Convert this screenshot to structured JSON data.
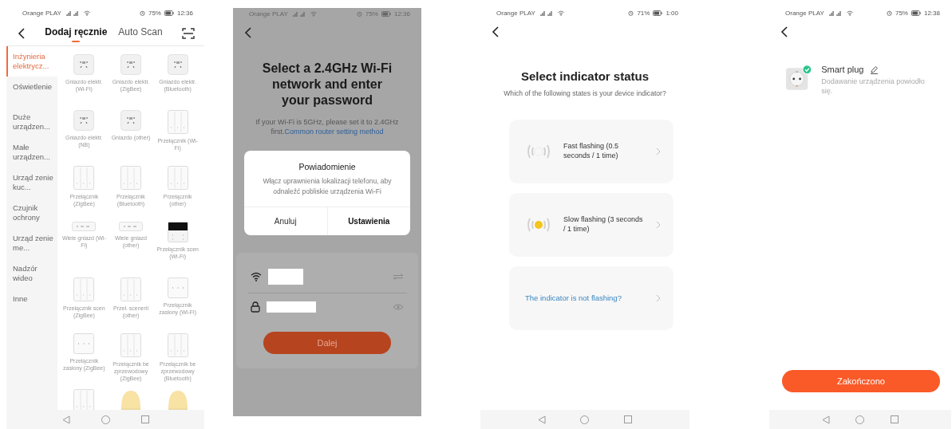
{
  "screens": [
    {
      "kind": "device_list",
      "status_bar": {
        "carrier": "Orange PLAY",
        "battery": "75%",
        "time": "12:36"
      },
      "tabs": [
        {
          "label": "Dodaj ręcznie",
          "selected": true
        },
        {
          "label": "Auto Scan",
          "selected": false
        }
      ],
      "categories": [
        {
          "label": "Inżynieria elektrycz...",
          "selected": true
        },
        {
          "label": "Oświetlenie",
          "selected": false
        },
        {
          "label": "Duże urządzen...",
          "selected": false
        },
        {
          "label": "Małe urządzen...",
          "selected": false
        },
        {
          "label": "Urząd zenie kuc...",
          "selected": false
        },
        {
          "label": "Czujnik ochrony",
          "selected": false
        },
        {
          "label": "Urząd zenie me...",
          "selected": false
        },
        {
          "label": "Nadzór wideo",
          "selected": false
        },
        {
          "label": "Inne",
          "selected": false
        }
      ],
      "devices": [
        {
          "kind": "socket",
          "label": "Gniazdo elektr. (Wi-Fi)"
        },
        {
          "kind": "socket",
          "label": "Gniazdo elektr. (ZigBee)"
        },
        {
          "kind": "socket",
          "label": "Gniazdo elektr. (Bluetooth)"
        },
        {
          "kind": "socket",
          "label": "Gniazdo elektr. (NB)"
        },
        {
          "kind": "socket",
          "label": "Gniazdo (other)"
        },
        {
          "kind": "switch",
          "label": "Przełącznik (Wi-Fi)"
        },
        {
          "kind": "switch",
          "label": "Przełącznik (ZigBee)"
        },
        {
          "kind": "switch",
          "label": "Przełącznik (Bluetooth)"
        },
        {
          "kind": "switch",
          "label": "Przełącznik (other)"
        },
        {
          "kind": "strip",
          "label": "Wiele gniazd (Wi-Fi)"
        },
        {
          "kind": "strip",
          "label": "Wiele gniazd (other)"
        },
        {
          "kind": "scene",
          "label": "Przełącznik scen (Wi-Fi)"
        },
        {
          "kind": "switch",
          "label": "Przełącznik scen (ZigBee)"
        },
        {
          "kind": "switch",
          "label": "Przeł. scenerii (other)"
        },
        {
          "kind": "curtain",
          "label": "Przełącznik zasłony (Wi-Fi)"
        },
        {
          "kind": "curtain",
          "label": "Przełącznik zasłony (ZigBee)"
        },
        {
          "kind": "switch",
          "label": "Przełącznik be zprzewodowy (ZigBee)"
        },
        {
          "kind": "switch",
          "label": "Przełącznik be zprzewodowy (Bluetooth)"
        },
        {
          "kind": "switch"
        },
        {
          "kind": "lamp"
        },
        {
          "kind": "lamp"
        }
      ]
    },
    {
      "kind": "wifi_setup",
      "status_bar": {
        "carrier": "Orange PLAY",
        "battery": "75%",
        "time": "12:36"
      },
      "title": "Select a 2.4GHz Wi-Fi network and enter your password",
      "hint": "If your Wi-Fi is 5GHz, please set it to 2.4GHz first.",
      "hint_link": "Common router setting method",
      "dialog": {
        "title": "Powiadomienie",
        "message": "Włącz uprawnienia lokalizacji telefonu, aby odnaleźć pobliskie urządzenia Wi-Fi",
        "buttons": [
          {
            "label": "Anuluj",
            "primary": false
          },
          {
            "label": "Ustawienia",
            "primary": true
          }
        ]
      },
      "next_button": "Dalej"
    },
    {
      "kind": "indicator",
      "status_bar": {
        "carrier": "Orange PLAY",
        "battery": "71%",
        "time": "1:00"
      },
      "title": "Select indicator status",
      "subtitle": "Which of the following states is your device indicator?",
      "options": [
        {
          "kind": "fast",
          "label": "Fast flashing (0.5 seconds / 1 time)"
        },
        {
          "kind": "slow",
          "label": "Slow flashing (3 seconds / 1 time)"
        },
        {
          "kind": "link",
          "label": "The indicator is not flashing?"
        }
      ]
    },
    {
      "kind": "done",
      "status_bar": {
        "carrier": "Orange PLAY",
        "battery": "75%",
        "time": "12:38"
      },
      "device": {
        "name": "Smart plug",
        "status": "Dodawanie urządzenia powiodło się.",
        "added": true
      },
      "finish_button": "Zakończono"
    }
  ]
}
